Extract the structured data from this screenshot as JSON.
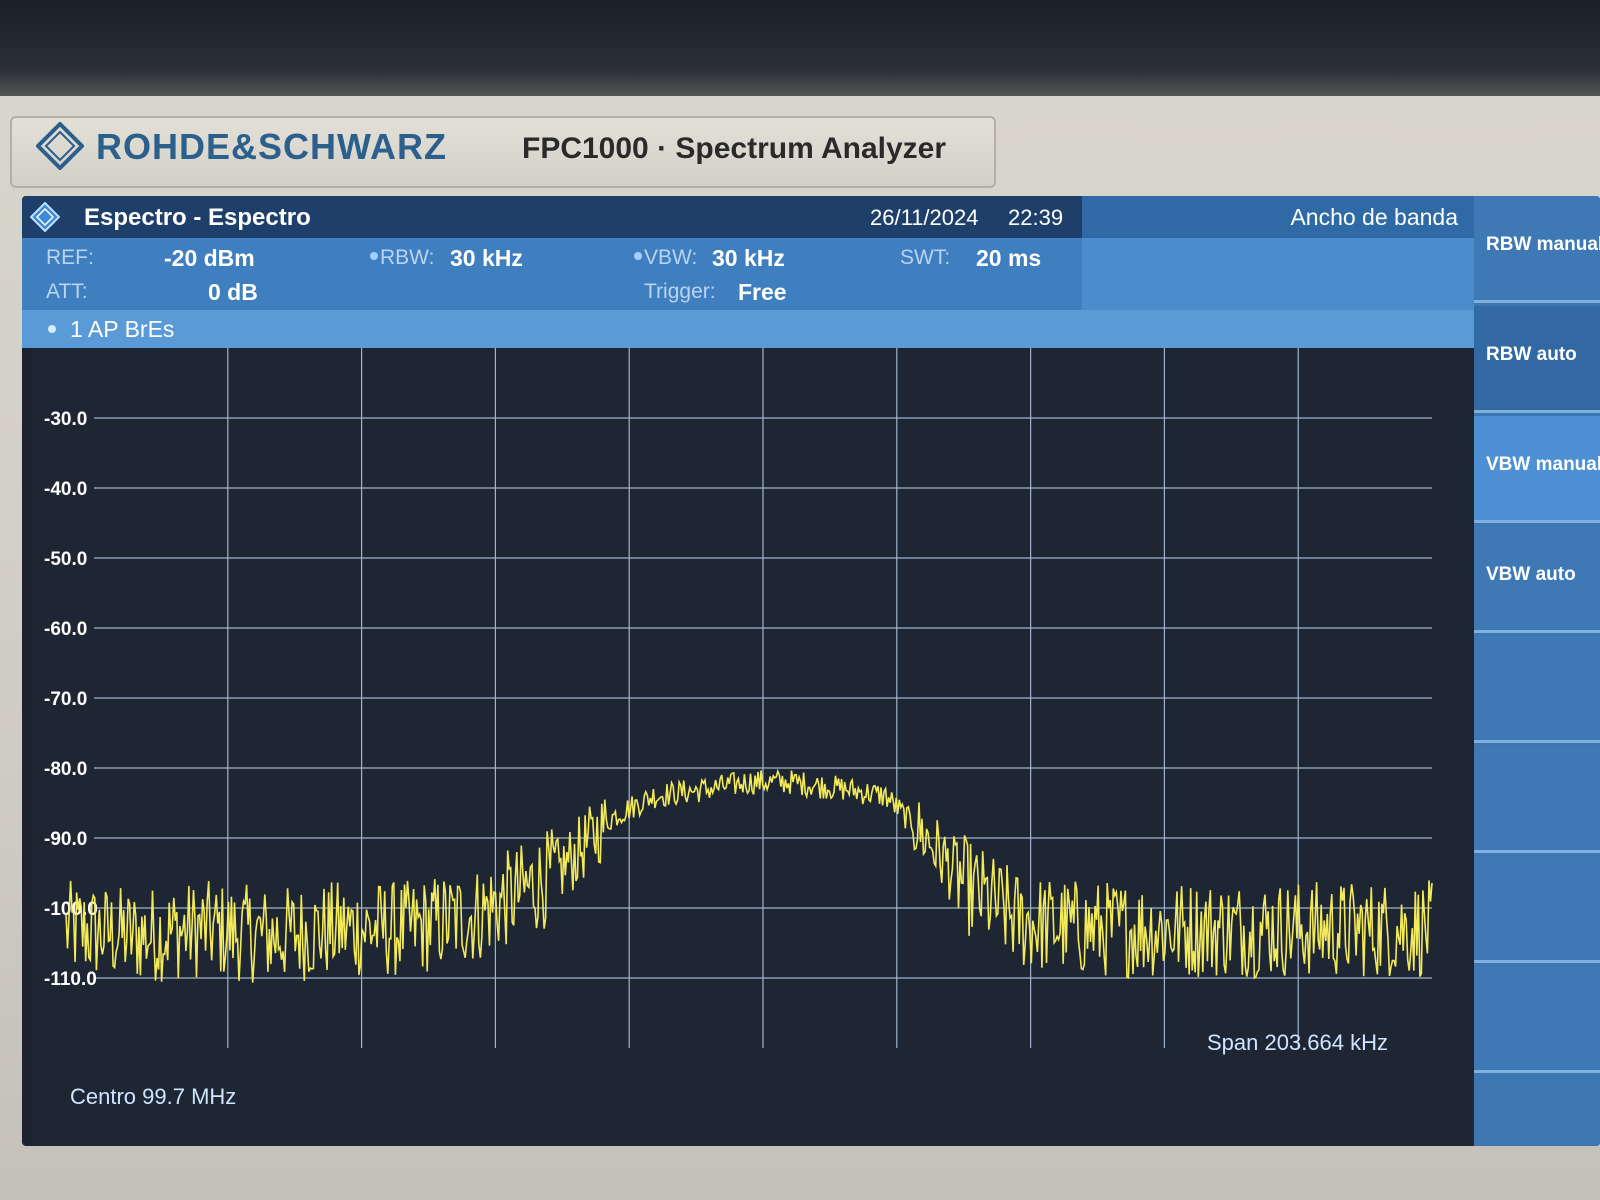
{
  "device": {
    "brand": "ROHDE&SCHWARZ",
    "model": "FPC1000 · Spectrum Analyzer"
  },
  "titlebar": {
    "title": "Espectro - Espectro",
    "date": "26/11/2024",
    "time": "22:39",
    "menu": "Ancho de banda"
  },
  "params": {
    "ref_label": "REF:",
    "ref_value": "-20 dBm",
    "att_label": "ATT:",
    "att_value": "0 dB",
    "rbw_label": "RBW:",
    "rbw_value": "30 kHz",
    "vbw_label": "VBW:",
    "vbw_value": "30 kHz",
    "trigger_label": "Trigger:",
    "trigger_value": "Free",
    "swt_label": "SWT:",
    "swt_value": "20 ms"
  },
  "trace": {
    "label": "1 AP  BrEs"
  },
  "softkeys": [
    {
      "label": "RBW manual"
    },
    {
      "label": "RBW auto"
    },
    {
      "label": "VBW manual"
    },
    {
      "label": "VBW auto"
    },
    {
      "label": ""
    },
    {
      "label": ""
    },
    {
      "label": ""
    },
    {
      "label": ""
    }
  ],
  "footer": {
    "center": "Centro 99.7 MHz",
    "span": "Span 203.664 kHz"
  },
  "colors": {
    "trace": "#f2ea58",
    "grid": "#9fb4cc",
    "titlebar": "#1f3f6b",
    "accent": "#3f7fc0"
  },
  "chart_data": {
    "type": "line",
    "y_ticks": [
      "-30.0",
      "-40.0",
      "-50.0",
      "-60.0",
      "-70.0",
      "-80.0",
      "-90.0",
      "-100.0",
      "-110.0"
    ],
    "ylim": [
      -120,
      -20
    ],
    "unit": "dBm",
    "series": [
      {
        "description": "yellow spectrum trace",
        "x": [
          0,
          0.05,
          0.1,
          0.15,
          0.2,
          0.25,
          0.3,
          0.33,
          0.36,
          0.4,
          0.43,
          0.47,
          0.5,
          0.53,
          0.57,
          0.6,
          0.63,
          0.66,
          0.7,
          0.75,
          0.8,
          0.85,
          0.9,
          0.95,
          1.0
        ],
        "values": [
          -103,
          -104,
          -103,
          -104,
          -103,
          -103,
          -101,
          -98,
          -95,
          -87,
          -84,
          -83,
          -82,
          -82,
          -83,
          -84,
          -90,
          -97,
          -102,
          -103,
          -103,
          -103,
          -103,
          -103,
          -103
        ]
      }
    ]
  }
}
